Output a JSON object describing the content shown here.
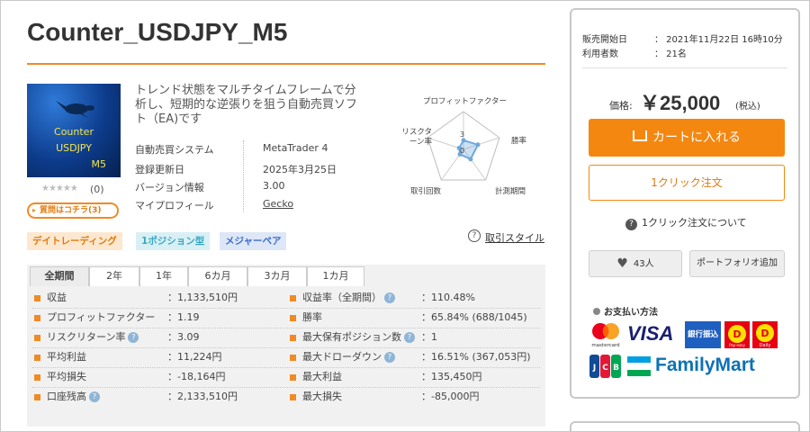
{
  "product": {
    "title": "Counter_USDJPY_M5",
    "thumbnail_lines": [
      "Counter",
      "USDJPY",
      "M5"
    ],
    "rating_stars": "★★★★★",
    "rating_count": "(0)",
    "qa_button": "質問はコチラ(3)",
    "description": "トレンド状態をマルチタイムフレームで分析し、短期的な逆張りを狙う自動売買ソフト（EA)です",
    "info": [
      {
        "label": "自動売買システム",
        "value": "MetaTrader 4"
      },
      {
        "label": "登録更新日",
        "value": "2025年3月25日"
      },
      {
        "label": "バージョン情報",
        "value": "3.00"
      },
      {
        "label": "マイプロフィール",
        "value": "Gecko"
      }
    ],
    "tags": [
      "デイトレーディング",
      "1ポジション型",
      "メジャーペア"
    ],
    "trade_style_link": "取引スタイル"
  },
  "radar": {
    "axes": [
      "プロフィットファクター",
      "勝率",
      "計測期間",
      "取引回数",
      "リスクターン率"
    ],
    "scale_labels": [
      "3",
      "0"
    ],
    "values": [
      1.2,
      2.0,
      1.6,
      0.8,
      0.6
    ],
    "max": 5,
    "fill_color": "#6fa8dc"
  },
  "tabs": [
    "全期間",
    "2年",
    "1年",
    "6カ月",
    "3カ月",
    "1カ月"
  ],
  "active_tab": 0,
  "stats_left": [
    {
      "label": "収益",
      "value": "：1,133,510円",
      "help": false
    },
    {
      "label": "プロフィットファクター",
      "value": "：1.19",
      "help": false
    },
    {
      "label": "リスクリターン率",
      "value": "：3.09",
      "help": true
    },
    {
      "label": "平均利益",
      "value": "：11,224円",
      "help": false
    },
    {
      "label": "平均損失",
      "value": "：-18,164円",
      "help": false
    },
    {
      "label": "口座残高",
      "value": "：2,133,510円",
      "help": true
    }
  ],
  "stats_right": [
    {
      "label": "収益率（全期間）",
      "value": "：110.48%",
      "help": true
    },
    {
      "label": "勝率",
      "value": "：65.84% (688/1045)",
      "help": false
    },
    {
      "label": "最大保有ポジション数",
      "value": "：1",
      "help": true
    },
    {
      "label": "最大ドローダウン",
      "value": "：16.51% (367,053円)",
      "help": true
    },
    {
      "label": "最大利益",
      "value": "：135,450円",
      "help": false
    },
    {
      "label": "最大損失",
      "value": "：-85,000円",
      "help": false
    }
  ],
  "sidebar": {
    "sale_start_label": "販売開始日",
    "sale_start_value": "：  2021年11月22日 16時10分",
    "users_label": "利用者数",
    "users_value": "：  21名",
    "price_label": "価格:",
    "price_value": "￥25,000",
    "price_tax": "(税込)",
    "cart_button": "カートに入れる",
    "oneclick_button": "1クリック注文",
    "oneclick_about": "1クリック注文について",
    "favorites_count": "43人",
    "portfolio_button": "ポートフォリオ追加",
    "payment_title": "お支払い方法",
    "payment_logos": [
      "mastercard",
      "VISA",
      "銀行振込",
      "Pay-easy",
      "Pay-easy",
      "JCB",
      "FamilyMart"
    ],
    "visa_text": "VISA",
    "bank_text": "銀行振込",
    "familymart_text": "FamilyMart",
    "mastercard_text": "mastercard",
    "jcb_text": "JCB",
    "payeasy_text": "Pay-easy",
    "daily_text": "Daily"
  },
  "colors": {
    "accent": "#f08a24",
    "cart": "#f4870f"
  }
}
